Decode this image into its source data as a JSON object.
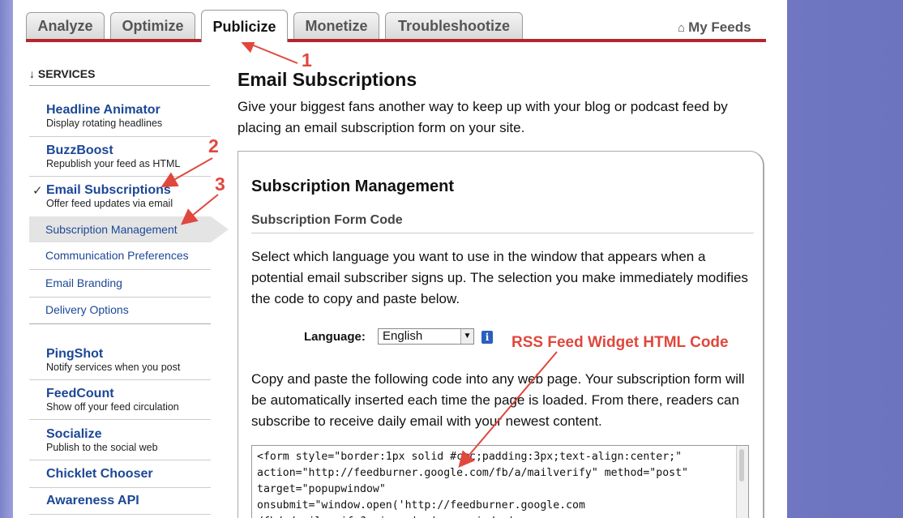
{
  "tabs": [
    {
      "label": "Analyze"
    },
    {
      "label": "Optimize"
    },
    {
      "label": "Publicize",
      "active": true
    },
    {
      "label": "Monetize"
    },
    {
      "label": "Troubleshootize"
    }
  ],
  "my_feeds_label": "My Feeds",
  "sidebar": {
    "header": "↓ SERVICES",
    "services": [
      {
        "title": "Headline Animator",
        "desc": "Display rotating headlines"
      },
      {
        "title": "BuzzBoost",
        "desc": "Republish your feed as HTML"
      },
      {
        "title": "Email Subscriptions",
        "desc": "Offer feed updates via email",
        "check": "✓"
      },
      {
        "title": "PingShot",
        "desc": "Notify services when you post"
      },
      {
        "title": "FeedCount",
        "desc": "Show off your feed circulation"
      },
      {
        "title": "Socialize",
        "desc": "Publish to the social web"
      },
      {
        "title": "Chicklet Chooser",
        "desc": ""
      },
      {
        "title": "Awareness API",
        "desc": ""
      }
    ],
    "subitems": [
      {
        "label": "Subscription Management",
        "active": true
      },
      {
        "label": "Communication Preferences"
      },
      {
        "label": "Email Branding"
      },
      {
        "label": "Delivery Options"
      }
    ]
  },
  "main": {
    "title": "Email Subscriptions",
    "intro": "Give your biggest fans another way to keep up with your blog or podcast feed by placing an email subscription form on your site.",
    "panel": {
      "title": "Subscription Management",
      "subtitle": "Subscription Form Code",
      "p1": "Select which language you want to use in the window that appears when a potential email subscriber signs up. The selection you make immediately modifies the code to copy and paste below.",
      "language_label": "Language:",
      "language_value": "English",
      "info_glyph": "i",
      "p2": "Copy and paste the following code into any web page. Your subscription form will be automatically inserted each time the page is loaded. From there, readers can subscribe to receive daily email with your newest content.",
      "code": "<form style=\"border:1px solid #ccc;padding:3px;text-align:center;\"\naction=\"http://feedburner.google.com/fb/a/mailverify\" method=\"post\"\ntarget=\"popupwindow\"\nonsubmit=\"window.open('http://feedburner.google.com\n/fb/a/mailverify?uri=...', 'popupwindow', ..."
    }
  },
  "annotations": {
    "n1": "1",
    "n2": "2",
    "n3": "3",
    "widget": "RSS Feed Widget HTML Code",
    "color": "#e0473d"
  }
}
